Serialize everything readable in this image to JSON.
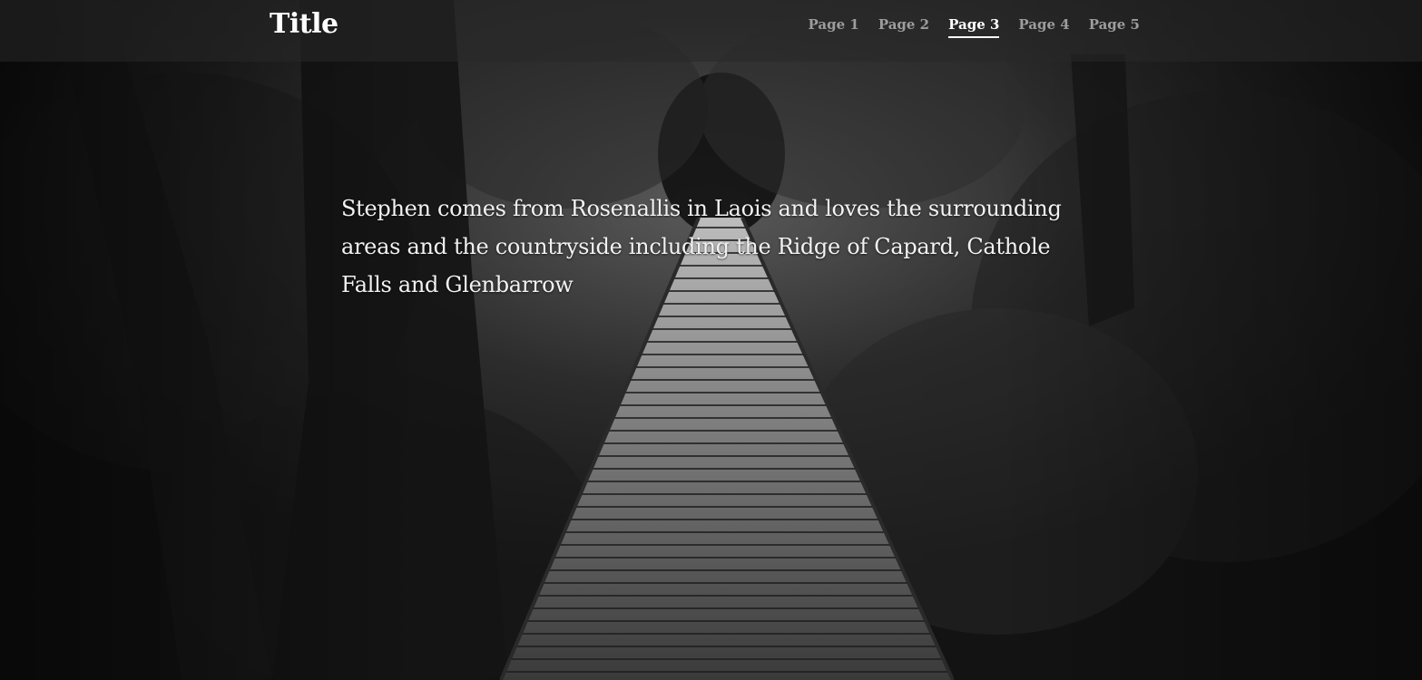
{
  "header": {
    "title": "Title",
    "nav": [
      {
        "label": "Page 1",
        "active": false
      },
      {
        "label": "Page 2",
        "active": false
      },
      {
        "label": "Page 3",
        "active": true
      },
      {
        "label": "Page 4",
        "active": false
      },
      {
        "label": "Page 5",
        "active": false
      }
    ]
  },
  "hero": {
    "text": "Stephen comes from Rosenallis in Laois and loves the surrounding areas and the countryside including the Ridge of Capard, Cathole Falls and Glenbarrow",
    "background_image": "forest-boardwalk-photo"
  },
  "colors": {
    "topbar": "#2a2a2a",
    "nav_inactive": "#9d9d9d",
    "nav_active": "#ffffff",
    "text": "#f2f2f2"
  }
}
